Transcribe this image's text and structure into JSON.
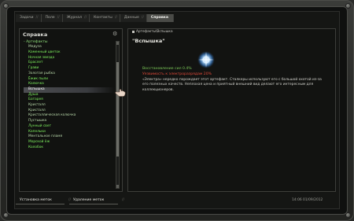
{
  "tabs": [
    "Задачи",
    "Поле",
    "Журнал",
    "Контакты",
    "Данные",
    "Справка"
  ],
  "active_tab": "Справка",
  "left_panel": {
    "title": "Справка",
    "category": "- Артефакты",
    "items": [
      {
        "label": "Медуза",
        "bright": false
      },
      {
        "label": "Каменный цветок",
        "bright": true
      },
      {
        "label": "Ночная звезда",
        "bright": true
      },
      {
        "label": "Браслет",
        "bright": true
      },
      {
        "label": "Грави",
        "bright": true
      },
      {
        "label": "Золотая рыбка",
        "bright": false
      },
      {
        "label": "Ёжик пыли",
        "bright": true
      },
      {
        "label": "Колючка",
        "bright": true
      },
      {
        "label": "Вспышка",
        "bright": true,
        "selected": true
      },
      {
        "label": "Душа",
        "bright": true
      },
      {
        "label": "Батарея",
        "bright": true
      },
      {
        "label": "Кристалл",
        "bright": false
      },
      {
        "label": "Кристалл",
        "bright": false
      },
      {
        "label": "Кристаллическая колючка",
        "bright": false
      },
      {
        "label": "Пустышка",
        "bright": false
      },
      {
        "label": "Лунный свет",
        "bright": true
      },
      {
        "label": "Капельки",
        "bright": true
      },
      {
        "label": "Ментальное пламя",
        "bright": false
      },
      {
        "label": "Морской ёж",
        "bright": true
      },
      {
        "label": "Колобок",
        "bright": true
      }
    ]
  },
  "right_panel": {
    "breadcrumb": "Артефакты\\Вспышка",
    "title": "\"Вспышка\"",
    "stat_positive": "Восстановление сил 0.4%",
    "stat_negative": "Уязвимость к электроразрядам 20%",
    "description": "«Электра» нередко порождает этот артефакт. Сталкеры используют его с большой охотой из-за его полезных качеств. Неплохая цена и приятный внешний вид делают его интересным для коллекционеров."
  },
  "bottom_tabs": [
    "Установка меток",
    "Удаление меток"
  ],
  "datetime": "14:06  01/09/2012",
  "colors": {
    "accent_green": "#7ff25f",
    "negative_red": "#e04a3a",
    "selected_bg": "#4d4e52"
  },
  "icons": {
    "options": "gear-icon",
    "cursor": "hand-cursor-icon",
    "artifact": "flash-artifact-icon"
  }
}
